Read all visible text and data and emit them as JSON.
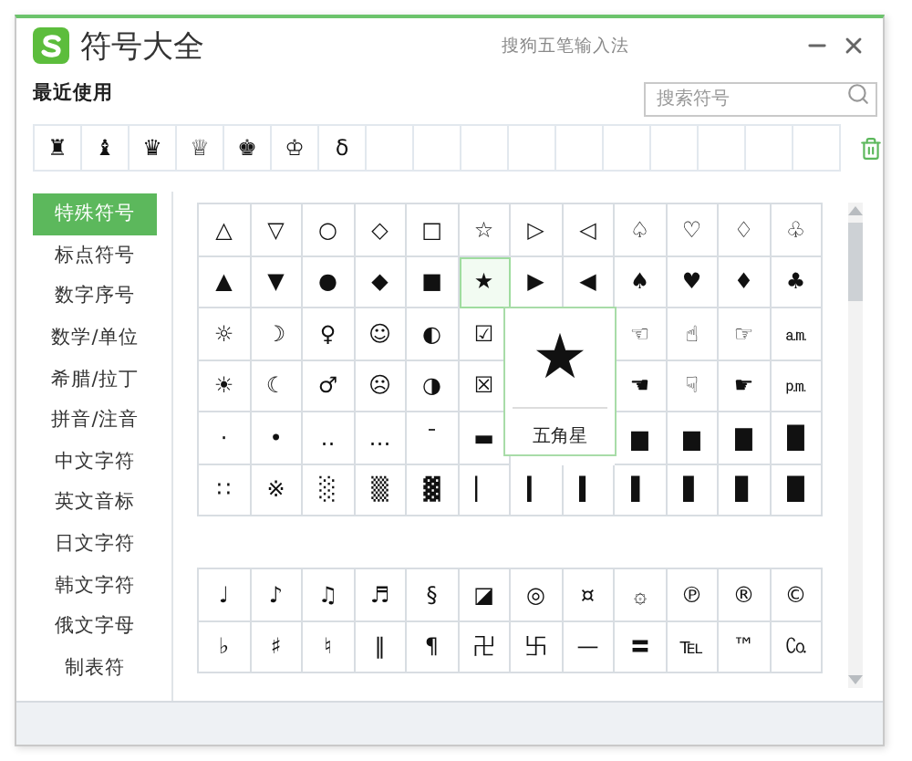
{
  "window": {
    "title": "符号大全",
    "ime_name": "搜狗五笔输入法"
  },
  "recent": {
    "label": "最近使用",
    "symbols": [
      "♜",
      "♝",
      "♛",
      "♕",
      "♚",
      "♔",
      "δ"
    ]
  },
  "search": {
    "placeholder": "搜索符号"
  },
  "categories": [
    {
      "label": "特殊符号",
      "selected": true
    },
    {
      "label": "标点符号",
      "selected": false
    },
    {
      "label": "数字序号",
      "selected": false
    },
    {
      "label": "数学/单位",
      "selected": false
    },
    {
      "label": "希腊/拉丁",
      "selected": false
    },
    {
      "label": "拼音/注音",
      "selected": false
    },
    {
      "label": "中文字符",
      "selected": false
    },
    {
      "label": "英文音标",
      "selected": false
    },
    {
      "label": "日文字符",
      "selected": false
    },
    {
      "label": "韩文字符",
      "selected": false
    },
    {
      "label": "俄文字母",
      "selected": false
    },
    {
      "label": "制表符",
      "selected": false
    }
  ],
  "grids": [
    {
      "rows": [
        [
          "△",
          "▽",
          "○",
          "◇",
          "□",
          "☆",
          "▷",
          "◁",
          "♤",
          "♡",
          "♢",
          "♧"
        ],
        [
          "▲",
          "▼",
          "●",
          "◆",
          "■",
          {
            "symbol": "★",
            "hovered": true
          },
          "▶",
          "◀",
          "♠",
          "♥",
          "♦",
          "♣"
        ],
        [
          "☼",
          "☽",
          "♀",
          "☺",
          "◐",
          "☑",
          null,
          null,
          "☜",
          "☝",
          "☞",
          "㏂"
        ],
        [
          "☀",
          "☾",
          "♂",
          "☹",
          "◑",
          "☒",
          null,
          null,
          "☚",
          "☟",
          "☛",
          "㏘"
        ],
        [
          "·",
          "•",
          "‥",
          "…",
          "¯",
          "▬",
          null,
          null,
          "▆",
          "▆",
          "▇",
          "█"
        ],
        [
          "∷",
          "※",
          "░",
          "▒",
          "▓",
          "▏",
          "▎",
          "▍",
          "▌",
          "▋",
          "▊",
          "█"
        ]
      ]
    },
    {
      "rows": [
        [
          "♩",
          "♪",
          "♫",
          "♬",
          "§",
          "◪",
          "◎",
          "¤",
          "۞",
          "℗",
          "®",
          "©"
        ],
        [
          "♭",
          "♯",
          "♮",
          "‖",
          "¶",
          "卍",
          "卐",
          "—",
          "〓",
          "℡",
          "™",
          "㏇"
        ]
      ]
    }
  ],
  "tooltip": {
    "symbol": "★",
    "label": "五角星"
  }
}
